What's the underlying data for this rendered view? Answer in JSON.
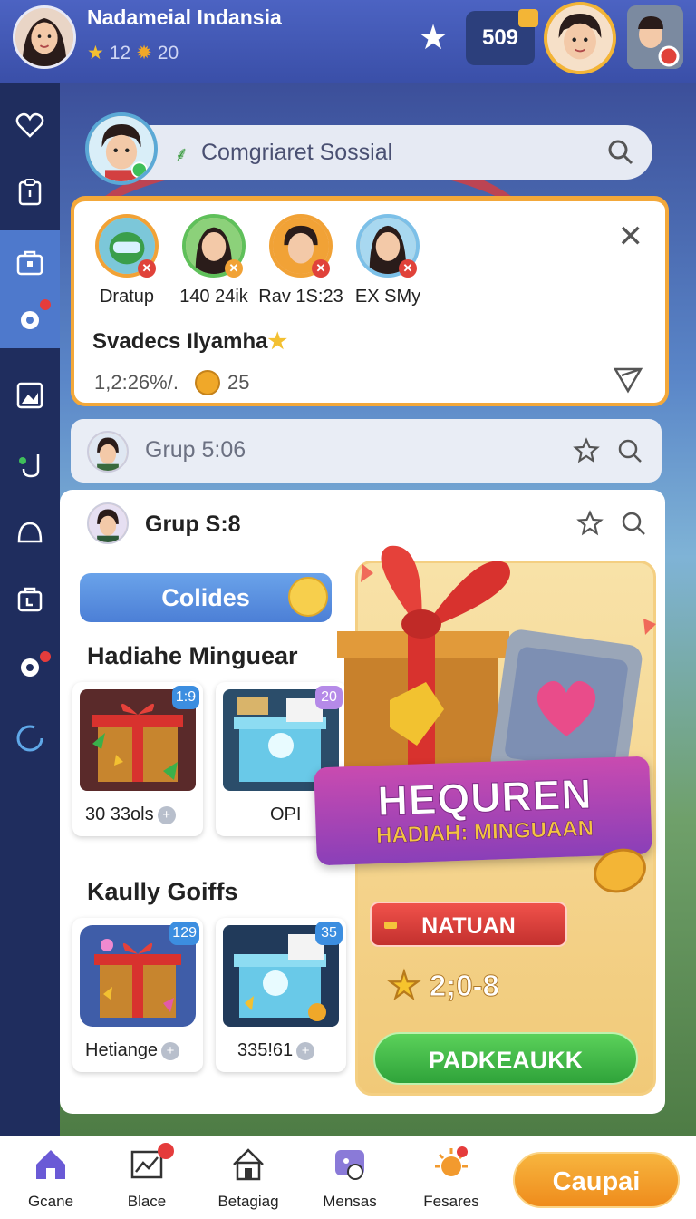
{
  "header": {
    "username": "Nadameial Indansia",
    "stars": "12",
    "coins": "20",
    "count": "509"
  },
  "search": {
    "placeholder": "Comgriaret Sossial"
  },
  "friends_panel": {
    "friends": [
      {
        "name": "Dratup"
      },
      {
        "name": "140 24ik"
      },
      {
        "name": "Rav 1S:23"
      },
      {
        "name": "EX SMy"
      }
    ],
    "group_name": "Svadecs Ilyamha",
    "stat_left": "1,2:26%/.",
    "stat_coins": "25"
  },
  "group_rows": [
    {
      "label": "Grup 5:06"
    },
    {
      "label": "Grup S:8"
    }
  ],
  "main": {
    "tab_label": "Colides",
    "section1_title": "Hadiahe Minguear",
    "section2_title": "Kaully Goiffs",
    "gifts": [
      {
        "badge": "1:9",
        "label": "30 33ols"
      },
      {
        "badge": "20",
        "label": "OPI"
      },
      {
        "badge": "129",
        "label": "Hetiange"
      },
      {
        "badge": "35",
        "label": "335!61"
      }
    ]
  },
  "promo": {
    "title": "HEQUREN",
    "subtitle": "HADIAH: MINGUAAN",
    "tag": "NATUAN",
    "price": "2;0-8",
    "button": "PADKEAUKK"
  },
  "bottom_nav": {
    "items": [
      {
        "label": "Gcane"
      },
      {
        "label": "Blace"
      },
      {
        "label": "Betagiag"
      },
      {
        "label": "Mensas"
      },
      {
        "label": "Fesares"
      }
    ],
    "cta": "Caupai"
  },
  "colors": {
    "header_bg": "#4c63c2",
    "sidebar_bg": "#1f2d5e",
    "accent_orange": "#f3a83a",
    "cta_green": "#2fa33a",
    "cta_orange": "#ef8c1c"
  },
  "icons": {
    "sidebar": [
      "heart-icon",
      "clipboard-icon",
      "briefcase-icon",
      "gear-icon",
      "picture-icon",
      "sync-icon",
      "profile-icon",
      "shop-icon",
      "gear-icon",
      "refresh-icon"
    ],
    "bottom_nav": [
      "home-icon",
      "chart-icon",
      "house-icon",
      "chat-icon",
      "sun-icon"
    ]
  }
}
